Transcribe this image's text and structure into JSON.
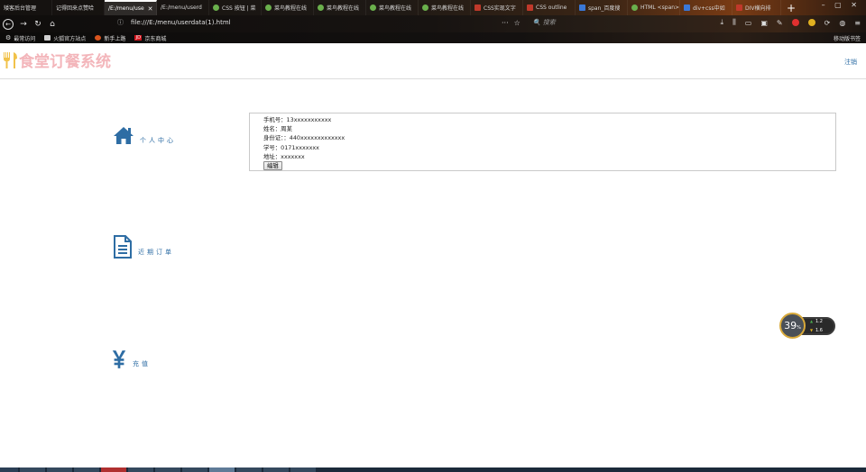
{
  "browser": {
    "tabs": [
      {
        "label": "矮客后台管理",
        "active": false
      },
      {
        "label": "记得回来点赞哈",
        "active": false
      },
      {
        "label": "/E:/menu/use",
        "active": true
      },
      {
        "label": "/E:/menu/userd",
        "active": false
      },
      {
        "label": "CSS 按钮 | 菜",
        "active": false
      },
      {
        "label": "菜鸟教程在线",
        "active": false
      },
      {
        "label": "菜鸟教程在线",
        "active": false
      },
      {
        "label": "菜鸟教程在线",
        "active": false
      },
      {
        "label": "菜鸟教程在线",
        "active": false
      },
      {
        "label": "CSS实现文字",
        "active": false
      },
      {
        "label": "CSS outline",
        "active": false
      },
      {
        "label": "span_百度搜",
        "active": false
      },
      {
        "label": "HTML <span>",
        "active": false
      },
      {
        "label": "div+css中如",
        "active": false
      },
      {
        "label": "DIV横向排",
        "active": false
      }
    ],
    "url": "file:///E:/menu/userdata(1).html",
    "search_placeholder": "搜索",
    "bookmarks": [
      {
        "label": "最常访问",
        "icon": "gear-icon"
      },
      {
        "label": "火狐官方站点",
        "icon": "folder-icon"
      },
      {
        "label": "新手上路",
        "icon": "firefox-icon"
      },
      {
        "label": "京东商城",
        "icon": "jd-icon"
      }
    ],
    "mobile_bookmarks": "移动版书签",
    "jd_badge": "JD"
  },
  "app": {
    "title": "食堂订餐系统",
    "logout_label": "注销",
    "brand_color": "#f3b5ba",
    "link_color": "#2e6da4"
  },
  "menu": [
    {
      "label": "个人中心",
      "icon": "home-icon"
    },
    {
      "label": "近期订单",
      "icon": "document-icon"
    },
    {
      "label": "充值",
      "icon": "yen-icon"
    }
  ],
  "profile": {
    "phone": "手机号：13xxxxxxxxxxx",
    "name": "姓名：周某",
    "id_card": "身份证：：440xxxxxxxxxxxxx",
    "student_id": "学号：0171xxxxxxx",
    "address": "地址：xxxxxxx",
    "edit_label": "编辑"
  },
  "speed_widget": {
    "value": "39",
    "unit": "%",
    "up": "1.2",
    "down": "1.6"
  }
}
